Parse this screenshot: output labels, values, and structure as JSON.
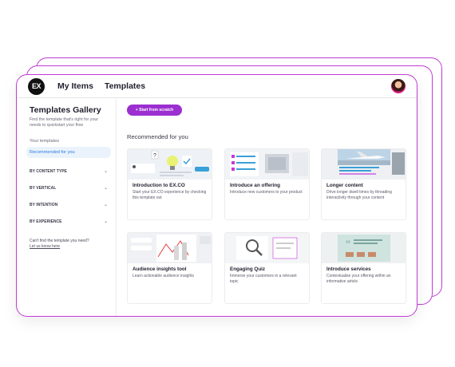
{
  "topbar": {
    "logo_text": "EX",
    "nav": [
      "My Items",
      "Templates"
    ]
  },
  "sidebar": {
    "title": "Templates Gallery",
    "subtitle": "Find the template that's right for your needs to quickstart your flow",
    "links": [
      {
        "label": "Your templates",
        "active": false
      },
      {
        "label": "Recommended for you",
        "active": true
      }
    ],
    "filters": [
      "BY CONTENT TYPE",
      "BY VERTICAL",
      "BY INTENTION",
      "BY EXPERIENCE"
    ],
    "cant_find": "Can't find the template you need?",
    "let_us_know": "Let us know here"
  },
  "main": {
    "start_button": "+ Start from scratch",
    "recommended_heading": "Recommended for you",
    "cards": [
      {
        "title": "Introduction to EX.CO",
        "desc": "Start your EX.CO experience by checking this template out"
      },
      {
        "title": "Introduce an offering",
        "desc": "Introduce new customers to your product"
      },
      {
        "title": "Longer content",
        "desc": "Drive longer dwell times by threading interactivity through your content"
      },
      {
        "title": "Audience insights tool",
        "desc": "Learn actionable audience insights"
      },
      {
        "title": "Engaging Quiz",
        "desc": "Immerse your customers in a relevant topic"
      },
      {
        "title": "Introduce services",
        "desc": "Contextualise your offering within an informative article"
      }
    ]
  },
  "colors": {
    "accent": "#9b2fd0",
    "frame": "#c23ad6",
    "active_link": "#2a7be0"
  }
}
